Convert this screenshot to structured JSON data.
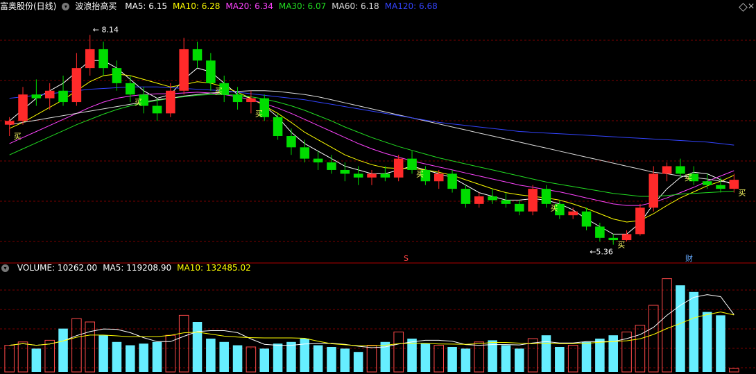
{
  "main_panel": {
    "stock_name": "富奥股份(日线)",
    "indicator_name": "波浪抬高买",
    "ma_labels": [
      {
        "text": "MA5: 6.15",
        "color": "#ffffff"
      },
      {
        "text": "MA10: 6.28",
        "color": "#ffff00"
      },
      {
        "text": "MA20: 6.34",
        "color": "#ff44ff"
      },
      {
        "text": "MA30: 6.07",
        "color": "#22dd22"
      },
      {
        "text": "MA60: 6.18",
        "color": "#dddddd"
      },
      {
        "text": "MA120: 6.68",
        "color": "#3344ff"
      }
    ],
    "high_label": "8.14",
    "low_label": "5.36",
    "buy_text": "买",
    "marker_s": "S",
    "marker_cai": "财"
  },
  "volume_panel": {
    "labels": [
      {
        "text": "VOLUME: 10262.00",
        "color": "#ffffff"
      },
      {
        "text": "MA5: 119208.90",
        "color": "#ffffff"
      },
      {
        "text": "MA10: 132485.02",
        "color": "#ffff00"
      }
    ]
  },
  "colors": {
    "up": "#ff2a2a",
    "down": "#00dd00",
    "grid": "#7a0000",
    "vol_up_border": "#ff4a4a",
    "vol_down": "#66eeff"
  },
  "chart_data": {
    "type": "candlestick",
    "price_ylim": [
      5.2,
      8.4
    ],
    "candles_ohlc": [
      [
        6.95,
        7.05,
        6.8,
        7.0
      ],
      [
        7.0,
        7.45,
        6.95,
        7.35
      ],
      [
        7.35,
        7.55,
        7.2,
        7.3
      ],
      [
        7.3,
        7.5,
        7.15,
        7.4
      ],
      [
        7.4,
        7.6,
        7.2,
        7.25
      ],
      [
        7.25,
        7.9,
        7.2,
        7.7
      ],
      [
        7.7,
        8.14,
        7.6,
        7.95
      ],
      [
        7.95,
        8.05,
        7.6,
        7.7
      ],
      [
        7.7,
        7.8,
        7.4,
        7.5
      ],
      [
        7.5,
        7.6,
        7.25,
        7.35
      ],
      [
        7.35,
        7.45,
        7.1,
        7.2
      ],
      [
        7.2,
        7.3,
        7.0,
        7.1
      ],
      [
        7.1,
        7.5,
        7.05,
        7.4
      ],
      [
        7.4,
        8.1,
        7.35,
        7.95
      ],
      [
        7.95,
        8.05,
        7.7,
        7.8
      ],
      [
        7.8,
        7.9,
        7.4,
        7.5
      ],
      [
        7.5,
        7.6,
        7.25,
        7.35
      ],
      [
        7.35,
        7.45,
        7.15,
        7.25
      ],
      [
        7.25,
        7.4,
        7.1,
        7.3
      ],
      [
        7.3,
        7.35,
        7.0,
        7.05
      ],
      [
        7.05,
        7.1,
        6.75,
        6.8
      ],
      [
        6.8,
        6.9,
        6.55,
        6.65
      ],
      [
        6.65,
        6.75,
        6.45,
        6.5
      ],
      [
        6.5,
        6.6,
        6.35,
        6.45
      ],
      [
        6.45,
        6.55,
        6.3,
        6.35
      ],
      [
        6.35,
        6.45,
        6.2,
        6.3
      ],
      [
        6.3,
        6.4,
        6.15,
        6.25
      ],
      [
        6.25,
        6.35,
        6.15,
        6.3
      ],
      [
        6.3,
        6.4,
        6.2,
        6.25
      ],
      [
        6.25,
        6.55,
        6.2,
        6.5
      ],
      [
        6.5,
        6.6,
        6.3,
        6.35
      ],
      [
        6.35,
        6.4,
        6.15,
        6.2
      ],
      [
        6.2,
        6.35,
        6.1,
        6.3
      ],
      [
        6.3,
        6.35,
        6.05,
        6.1
      ],
      [
        6.1,
        6.15,
        5.85,
        5.9
      ],
      [
        5.9,
        6.05,
        5.85,
        6.0
      ],
      [
        6.0,
        6.1,
        5.9,
        5.95
      ],
      [
        5.95,
        6.05,
        5.85,
        5.9
      ],
      [
        5.9,
        5.95,
        5.75,
        5.8
      ],
      [
        5.8,
        6.15,
        5.75,
        6.1
      ],
      [
        6.1,
        6.15,
        5.85,
        5.9
      ],
      [
        5.9,
        5.95,
        5.7,
        5.75
      ],
      [
        5.75,
        5.85,
        5.7,
        5.8
      ],
      [
        5.8,
        5.85,
        5.55,
        5.6
      ],
      [
        5.6,
        5.65,
        5.4,
        5.45
      ],
      [
        5.45,
        5.5,
        5.36,
        5.42
      ],
      [
        5.42,
        5.55,
        5.4,
        5.5
      ],
      [
        5.5,
        5.9,
        5.48,
        5.85
      ],
      [
        5.85,
        6.4,
        5.8,
        6.3
      ],
      [
        6.3,
        6.45,
        6.2,
        6.4
      ],
      [
        6.4,
        6.5,
        6.25,
        6.3
      ],
      [
        6.3,
        6.4,
        6.15,
        6.2
      ],
      [
        6.2,
        6.3,
        6.1,
        6.15
      ],
      [
        6.15,
        6.25,
        6.05,
        6.1
      ],
      [
        6.1,
        6.3,
        6.05,
        6.22
      ]
    ],
    "ma_series": [
      {
        "name": "MA5",
        "color": "#ffffff",
        "values": [
          7.0,
          7.15,
          7.3,
          7.4,
          7.5,
          7.65,
          7.8,
          7.8,
          7.7,
          7.55,
          7.4,
          7.3,
          7.35,
          7.55,
          7.7,
          7.65,
          7.5,
          7.35,
          7.3,
          7.2,
          7.05,
          6.85,
          6.7,
          6.6,
          6.5,
          6.4,
          6.35,
          6.3,
          6.3,
          6.35,
          6.4,
          6.35,
          6.3,
          6.25,
          6.15,
          6.05,
          6.0,
          5.95,
          5.95,
          5.97,
          5.95,
          5.9,
          5.82,
          5.7,
          5.6,
          5.5,
          5.5,
          5.65,
          5.9,
          6.1,
          6.25,
          6.32,
          6.3,
          6.22,
          6.15
        ]
      },
      {
        "name": "MA10",
        "color": "#ffff00",
        "values": [
          6.9,
          6.98,
          7.08,
          7.18,
          7.28,
          7.4,
          7.52,
          7.6,
          7.62,
          7.6,
          7.55,
          7.5,
          7.45,
          7.48,
          7.52,
          7.5,
          7.45,
          7.38,
          7.3,
          7.2,
          7.1,
          6.98,
          6.85,
          6.75,
          6.65,
          6.55,
          6.48,
          6.42,
          6.38,
          6.37,
          6.37,
          6.35,
          6.32,
          6.28,
          6.22,
          6.16,
          6.1,
          6.05,
          6.02,
          6.0,
          5.98,
          5.95,
          5.9,
          5.84,
          5.77,
          5.7,
          5.66,
          5.68,
          5.77,
          5.88,
          5.98,
          6.06,
          6.14,
          6.2,
          6.28
        ]
      },
      {
        "name": "MA20",
        "color": "#ff44ff",
        "values": [
          6.7,
          6.78,
          6.86,
          6.94,
          7.02,
          7.1,
          7.18,
          7.25,
          7.3,
          7.33,
          7.35,
          7.36,
          7.36,
          7.37,
          7.38,
          7.37,
          7.35,
          7.32,
          7.28,
          7.23,
          7.17,
          7.1,
          7.02,
          6.94,
          6.86,
          6.78,
          6.7,
          6.63,
          6.57,
          6.52,
          6.47,
          6.43,
          6.39,
          6.35,
          6.31,
          6.27,
          6.23,
          6.19,
          6.15,
          6.12,
          6.09,
          6.06,
          6.02,
          5.98,
          5.94,
          5.9,
          5.88,
          5.88,
          5.92,
          5.98,
          6.05,
          6.12,
          6.2,
          6.27,
          6.34
        ]
      },
      {
        "name": "MA30",
        "color": "#22dd22",
        "values": [
          6.55,
          6.63,
          6.71,
          6.79,
          6.87,
          6.95,
          7.02,
          7.09,
          7.15,
          7.2,
          7.24,
          7.27,
          7.3,
          7.32,
          7.34,
          7.35,
          7.35,
          7.34,
          7.32,
          7.29,
          7.25,
          7.2,
          7.14,
          7.07,
          7.0,
          6.92,
          6.85,
          6.78,
          6.72,
          6.66,
          6.61,
          6.56,
          6.51,
          6.47,
          6.43,
          6.39,
          6.35,
          6.31,
          6.27,
          6.23,
          6.19,
          6.16,
          6.13,
          6.1,
          6.07,
          6.04,
          6.02,
          6.0,
          6.0,
          6.01,
          6.03,
          6.04,
          6.05,
          6.06,
          6.07
        ]
      },
      {
        "name": "MA60",
        "color": "#dddddd",
        "values": [
          6.95,
          6.98,
          7.01,
          7.04,
          7.07,
          7.1,
          7.13,
          7.16,
          7.19,
          7.22,
          7.25,
          7.28,
          7.3,
          7.33,
          7.35,
          7.37,
          7.38,
          7.39,
          7.4,
          7.4,
          7.39,
          7.37,
          7.35,
          7.32,
          7.28,
          7.24,
          7.2,
          7.16,
          7.12,
          7.08,
          7.04,
          7.0,
          6.96,
          6.92,
          6.88,
          6.84,
          6.8,
          6.76,
          6.72,
          6.68,
          6.64,
          6.6,
          6.56,
          6.52,
          6.48,
          6.44,
          6.4,
          6.36,
          6.32,
          6.3,
          6.27,
          6.25,
          6.23,
          6.2,
          6.18
        ]
      },
      {
        "name": "MA120",
        "color": "#3344ff",
        "values": [
          7.3,
          7.32,
          7.34,
          7.36,
          7.38,
          7.4,
          7.42,
          7.43,
          7.44,
          7.45,
          7.45,
          7.45,
          7.44,
          7.43,
          7.42,
          7.41,
          7.4,
          7.38,
          7.36,
          7.34,
          7.32,
          7.3,
          7.28,
          7.25,
          7.22,
          7.19,
          7.16,
          7.13,
          7.1,
          7.07,
          7.04,
          7.01,
          6.98,
          6.96,
          6.94,
          6.92,
          6.9,
          6.88,
          6.86,
          6.85,
          6.84,
          6.83,
          6.82,
          6.81,
          6.8,
          6.79,
          6.78,
          6.77,
          6.76,
          6.75,
          6.74,
          6.73,
          6.72,
          6.7,
          6.68
        ]
      }
    ],
    "buy_signal_candles": [
      0,
      9,
      15,
      18,
      30,
      40,
      45,
      50,
      54
    ],
    "volume": [
      80000,
      90000,
      70000,
      95000,
      130000,
      160000,
      150000,
      110000,
      90000,
      80000,
      85000,
      90000,
      110000,
      170000,
      150000,
      100000,
      90000,
      80000,
      75000,
      70000,
      85000,
      90000,
      100000,
      80000,
      75000,
      70000,
      60000,
      80000,
      90000,
      120000,
      100000,
      85000,
      80000,
      75000,
      70000,
      90000,
      95000,
      80000,
      70000,
      100000,
      110000,
      75000,
      80000,
      90000,
      100000,
      110000,
      120000,
      140000,
      200000,
      280000,
      260000,
      240000,
      180000,
      170000,
      10262
    ],
    "volume_ylim": [
      0,
      300000
    ]
  }
}
